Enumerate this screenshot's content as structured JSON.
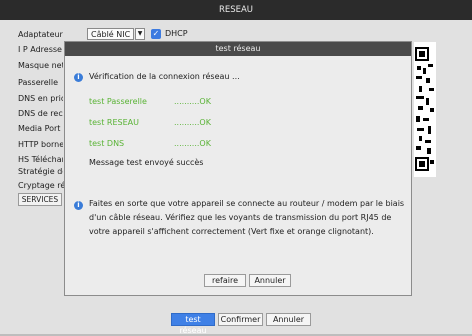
{
  "header": {
    "title": "RESEAU"
  },
  "form": {
    "labels": [
      "Adaptateur",
      "I P Adresse",
      "Masque net",
      "Passerelle",
      "DNS en prior",
      "DNS de rech",
      "Media Port",
      "HTTP borne",
      "HS Télécharg",
      "Stratégie de",
      "Cryptage rés"
    ],
    "adapter_value": "Câblé NIC",
    "dhcp_label": "DHCP",
    "dhcp_checked": true,
    "services_button": "SERVICES"
  },
  "dialog": {
    "title": "test réseau",
    "checking_text": "Vérification de la connexion réseau ...",
    "tests": [
      {
        "name": "test Passerelle",
        "result": "..........OK"
      },
      {
        "name": "test RESEAU",
        "result": "..........OK"
      },
      {
        "name": "test DNS",
        "result": "..........OK"
      }
    ],
    "message_sent": "Message test envoyé succès",
    "note": "Faites en sorte que votre appareil se connecte au routeur / modem par le biais d'un câble réseau. Vérifiez que les voyants de transmission du port RJ45 de votre appareil s'affichent correctement (Vert fixe et orange clignotant).",
    "redo_button": "refaire",
    "cancel_button": "Annuler"
  },
  "footer": {
    "test_button": "test réseau",
    "confirm_button": "Confirmer",
    "cancel_button": "Annuler"
  },
  "colors": {
    "accent": "#3f80e6",
    "ok_green": "#5ab336",
    "header_bg": "#2b2b2b"
  }
}
